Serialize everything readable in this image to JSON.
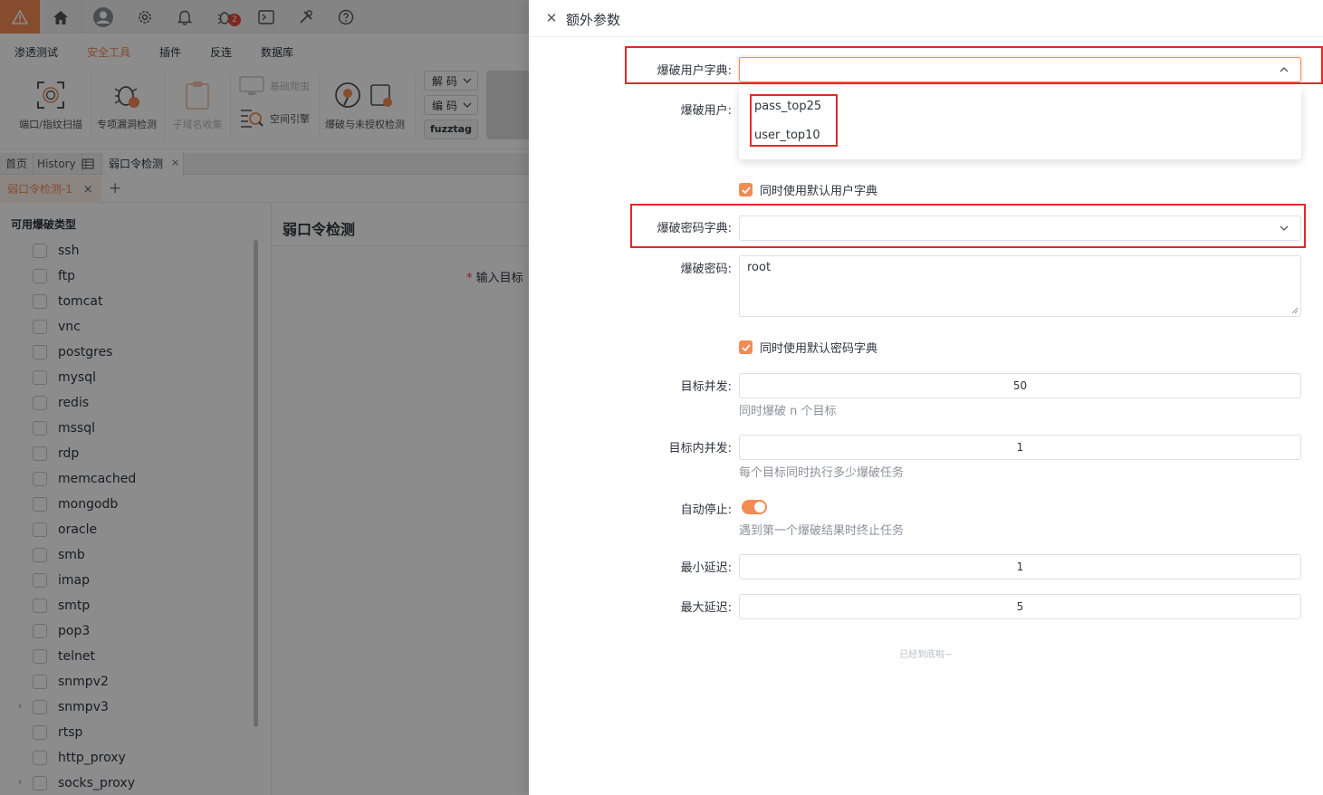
{
  "topbar": {
    "bug_badge": "2"
  },
  "menu": {
    "items": [
      "渗透测试",
      "安全工具",
      "插件",
      "反连",
      "数据库"
    ],
    "active": "安全工具"
  },
  "toolbar": {
    "tools": [
      {
        "label": "端口/指纹扫描"
      },
      {
        "label": "专项漏洞检测"
      },
      {
        "label": "子域名收集"
      },
      {
        "label": "基础爬虫"
      },
      {
        "label": "空间引擎"
      },
      {
        "label": "爆破与未授权检测"
      }
    ],
    "decode_label": "解 码",
    "encode_label": "编 码",
    "fuzztag_label": "fuzztag"
  },
  "page_tabs": {
    "home": "首页",
    "history": "History",
    "active": "弱口令检测"
  },
  "sub_tab": {
    "label": "弱口令检测-1",
    "add": "+"
  },
  "sidebar": {
    "title": "可用爆破类型",
    "items": [
      "ssh",
      "ftp",
      "tomcat",
      "vnc",
      "postgres",
      "mysql",
      "redis",
      "mssql",
      "rdp",
      "memcached",
      "mongodb",
      "oracle",
      "smb",
      "imap",
      "smtp",
      "pop3",
      "telnet",
      "snmpv2",
      "snmpv3",
      "rtsp",
      "http_proxy",
      "socks_proxy"
    ]
  },
  "main": {
    "title": "弱口令检测",
    "target_label": "输入目标"
  },
  "drawer": {
    "title": "额外参数",
    "user_dict_label": "爆破用户字典:",
    "user_label": "爆破用户:",
    "dropdown_options": [
      "pass_top25",
      "user_top10"
    ],
    "use_default_user_dict": "同时使用默认用户字典",
    "pass_dict_label": "爆破密码字典:",
    "password_label": "爆破密码:",
    "password_value": "root",
    "use_default_pass_dict": "同时使用默认密码字典",
    "target_concurrency_label": "目标并发:",
    "target_concurrency_value": "50",
    "target_concurrency_hint": "同时爆破 n 个目标",
    "inner_concurrency_label": "目标内并发:",
    "inner_concurrency_value": "1",
    "inner_concurrency_hint": "每个目标同时执行多少爆破任务",
    "auto_stop_label": "自动停止:",
    "auto_stop_on": true,
    "auto_stop_hint": "遇到第一个爆破结果时终止任务",
    "min_delay_label": "最小延迟:",
    "min_delay_value": "1",
    "max_delay_label": "最大延迟:",
    "max_delay_value": "5",
    "bottom_note": "已经到底啦~"
  },
  "colors": {
    "accent": "#f28b54",
    "highlight_box": "#e8262a"
  }
}
